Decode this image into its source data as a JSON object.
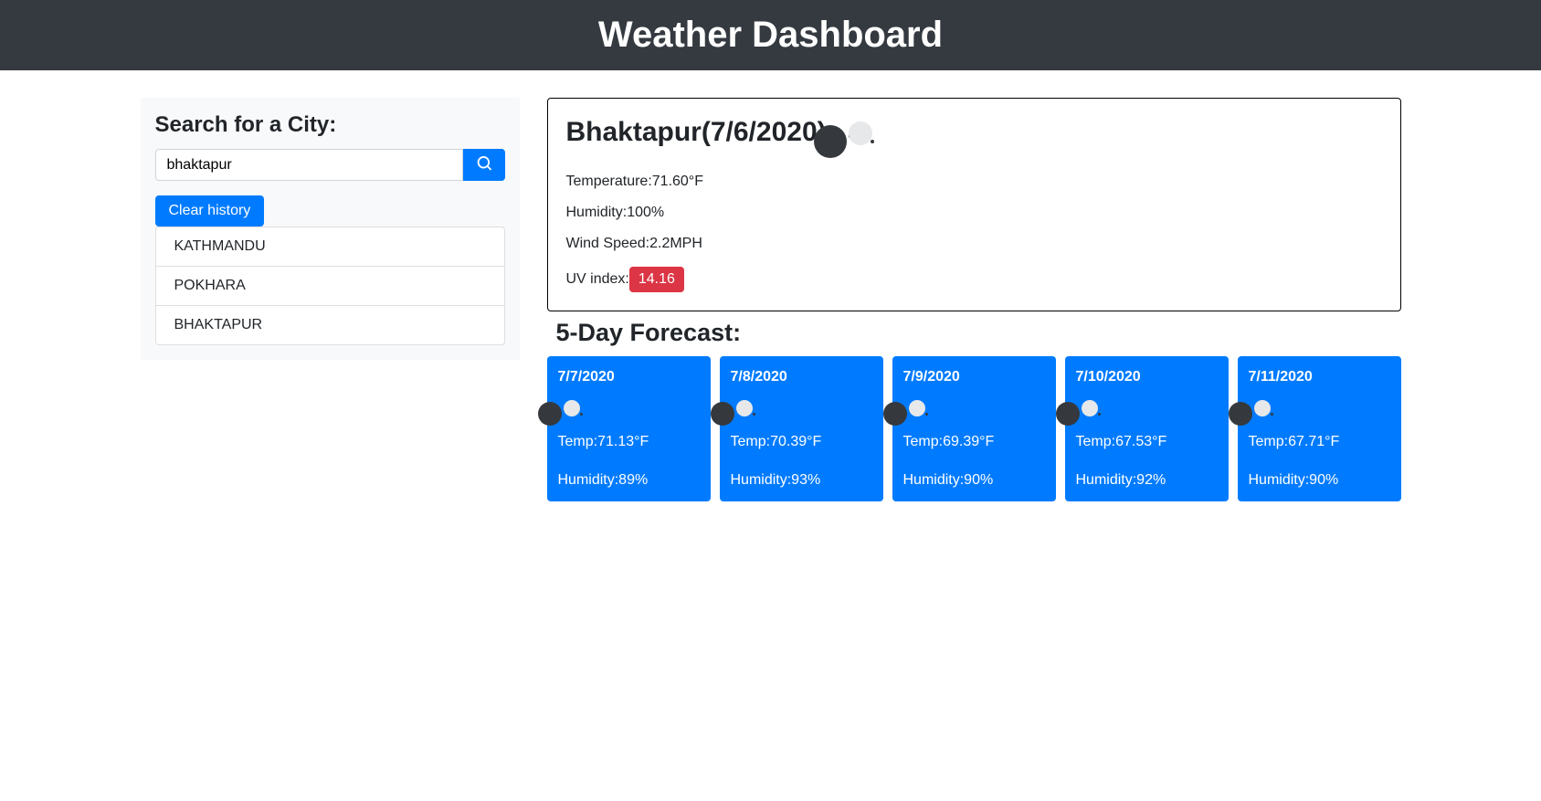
{
  "header": {
    "title": "Weather Dashboard"
  },
  "sidebar": {
    "search_heading": "Search for a City:",
    "search_value": "bhaktapur",
    "clear_label": "Clear history",
    "history": [
      "KATHMANDU",
      "POKHARA",
      "BHAKTAPUR"
    ]
  },
  "current": {
    "title": "Bhaktapur(7/6/2020)",
    "temp_label": "Temperature:",
    "temp_value": "71.60°F",
    "humidity_label": "Humidity:",
    "humidity_value": "100%",
    "wind_label": "Wind Speed:",
    "wind_value": "2.2MPH",
    "uv_label": "UV index:",
    "uv_value": "14.16"
  },
  "forecast": {
    "heading": "5-Day Forecast:",
    "days": [
      {
        "date": "7/7/2020",
        "temp": "Temp:71.13°F",
        "humidity": "Humidity:89%"
      },
      {
        "date": "7/8/2020",
        "temp": "Temp:70.39°F",
        "humidity": "Humidity:93%"
      },
      {
        "date": "7/9/2020",
        "temp": "Temp:69.39°F",
        "humidity": "Humidity:90%"
      },
      {
        "date": "7/10/2020",
        "temp": "Temp:67.53°F",
        "humidity": "Humidity:92%"
      },
      {
        "date": "7/11/2020",
        "temp": "Temp:67.71°F",
        "humidity": "Humidity:90%"
      }
    ]
  }
}
